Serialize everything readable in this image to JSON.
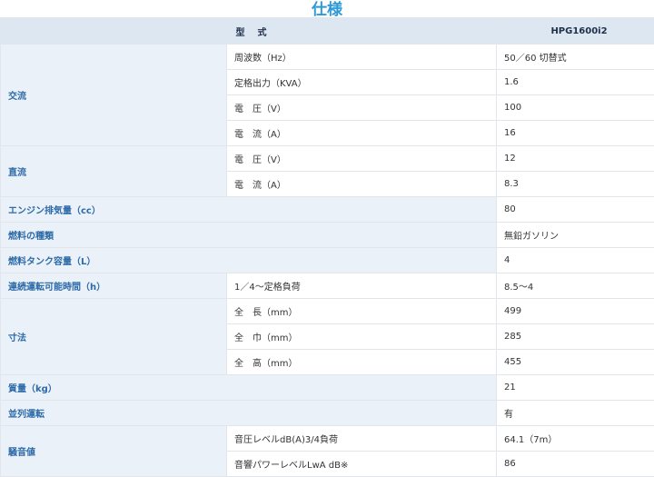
{
  "title": "仕様",
  "header": {
    "label": "型　式",
    "model": "HPG1600i2"
  },
  "ac": {
    "label": "交流",
    "freq": {
      "label": "周波数（Hz）",
      "value": "50／60 切替式"
    },
    "output": {
      "label": "定格出力（KVA）",
      "value": "1.6"
    },
    "voltage": {
      "label": "電　圧（V）",
      "value": "100"
    },
    "current": {
      "label": "電　流（A）",
      "value": "16"
    }
  },
  "dc": {
    "label": "直流",
    "voltage": {
      "label": "電　圧（V）",
      "value": "12"
    },
    "current": {
      "label": "電　流（A）",
      "value": "8.3"
    }
  },
  "displacement": {
    "label": "エンジン排気量（cc）",
    "value": "80"
  },
  "fuel_type": {
    "label": "燃料の種類",
    "value": "無鉛ガソリン"
  },
  "tank": {
    "label": "燃料タンク容量（L）",
    "value": "4"
  },
  "runtime": {
    "label": "連続運転可能時間（h）",
    "condition": "1／4〜定格負荷",
    "value": "8.5〜4"
  },
  "dimensions": {
    "label": "寸法",
    "length": {
      "label": "全　長（mm）",
      "value": "499"
    },
    "width": {
      "label": "全　巾（mm）",
      "value": "285"
    },
    "height": {
      "label": "全　高（mm）",
      "value": "455"
    }
  },
  "weight": {
    "label": "質量（kg）",
    "value": "21"
  },
  "parallel": {
    "label": "並列運転",
    "value": "有"
  },
  "noise": {
    "label": "騒音値",
    "pressure": {
      "label": "音圧レベルdB(A)3/4負荷",
      "value": "64.1（7m）"
    },
    "power": {
      "label": "音響パワーレベルLwA dB※",
      "value": "86"
    }
  }
}
